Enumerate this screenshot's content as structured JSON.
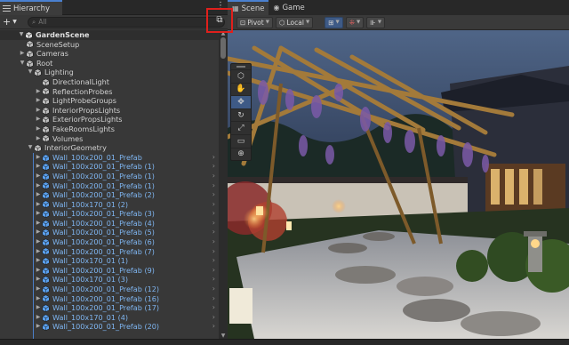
{
  "hierarchy": {
    "tab_label": "Hierarchy",
    "add_label": "+",
    "search_placeholder": "All",
    "items": [
      {
        "label": "GardenScene",
        "indent": 0,
        "arrow": "down",
        "kind": "scene"
      },
      {
        "label": "SceneSetup",
        "indent": 1,
        "arrow": "",
        "kind": "normal"
      },
      {
        "label": "Cameras",
        "indent": 1,
        "arrow": "right",
        "kind": "normal"
      },
      {
        "label": "Root",
        "indent": 1,
        "arrow": "down",
        "kind": "normal"
      },
      {
        "label": "Lighting",
        "indent": 2,
        "arrow": "down",
        "kind": "normal"
      },
      {
        "label": "DirectionalLight",
        "indent": 3,
        "arrow": "",
        "kind": "normal"
      },
      {
        "label": "ReflectionProbes",
        "indent": 3,
        "arrow": "right",
        "kind": "normal"
      },
      {
        "label": "LightProbeGroups",
        "indent": 3,
        "arrow": "right",
        "kind": "normal"
      },
      {
        "label": "InteriorPropsLights",
        "indent": 3,
        "arrow": "right",
        "kind": "normal"
      },
      {
        "label": "ExteriorPropsLights",
        "indent": 3,
        "arrow": "right",
        "kind": "normal"
      },
      {
        "label": "FakeRoomsLights",
        "indent": 3,
        "arrow": "right",
        "kind": "normal"
      },
      {
        "label": "Volumes",
        "indent": 3,
        "arrow": "right",
        "kind": "normal"
      },
      {
        "label": "InteriorGeometry",
        "indent": 2,
        "arrow": "down",
        "kind": "normal"
      },
      {
        "label": "Wall_100x200_01_Prefab",
        "indent": 3,
        "arrow": "right",
        "kind": "prefab"
      },
      {
        "label": "Wall_100x200_01_Prefab (1)",
        "indent": 3,
        "arrow": "right",
        "kind": "prefab"
      },
      {
        "label": "Wall_100x200_01_Prefab (1)",
        "indent": 3,
        "arrow": "right",
        "kind": "prefab"
      },
      {
        "label": "Wall_100x200_01_Prefab (1)",
        "indent": 3,
        "arrow": "right",
        "kind": "prefab"
      },
      {
        "label": "Wall_100x200_01_Prefab (2)",
        "indent": 3,
        "arrow": "right",
        "kind": "prefab"
      },
      {
        "label": "Wall_100x170_01 (2)",
        "indent": 3,
        "arrow": "right",
        "kind": "prefab"
      },
      {
        "label": "Wall_100x200_01_Prefab (3)",
        "indent": 3,
        "arrow": "right",
        "kind": "prefab"
      },
      {
        "label": "Wall_100x200_01_Prefab (4)",
        "indent": 3,
        "arrow": "right",
        "kind": "prefab"
      },
      {
        "label": "Wall_100x200_01_Prefab (5)",
        "indent": 3,
        "arrow": "right",
        "kind": "prefab"
      },
      {
        "label": "Wall_100x200_01_Prefab (6)",
        "indent": 3,
        "arrow": "right",
        "kind": "prefab"
      },
      {
        "label": "Wall_100x200_01_Prefab (7)",
        "indent": 3,
        "arrow": "right",
        "kind": "prefab"
      },
      {
        "label": "Wall_100x170_01 (1)",
        "indent": 3,
        "arrow": "right",
        "kind": "prefab"
      },
      {
        "label": "Wall_100x200_01_Prefab (9)",
        "indent": 3,
        "arrow": "right",
        "kind": "prefab"
      },
      {
        "label": "Wall_100x170_01 (3)",
        "indent": 3,
        "arrow": "right",
        "kind": "prefab"
      },
      {
        "label": "Wall_100x200_01_Prefab (12)",
        "indent": 3,
        "arrow": "right",
        "kind": "prefab"
      },
      {
        "label": "Wall_100x200_01_Prefab (16)",
        "indent": 3,
        "arrow": "right",
        "kind": "prefab"
      },
      {
        "label": "Wall_100x200_01_Prefab (17)",
        "indent": 3,
        "arrow": "right",
        "kind": "prefab"
      },
      {
        "label": "Wall_100x170_01 (4)",
        "indent": 3,
        "arrow": "right",
        "kind": "prefab"
      },
      {
        "label": "Wall_100x200_01_Prefab (20)",
        "indent": 3,
        "arrow": "right",
        "kind": "prefab"
      }
    ]
  },
  "scene_view": {
    "tabs": [
      {
        "label": "Scene",
        "icon": "grid-icon",
        "active": true
      },
      {
        "label": "Game",
        "icon": "gamepad-icon",
        "active": false
      }
    ],
    "toolbar": {
      "pivot_label": "Pivot",
      "local_label": "Local"
    },
    "tools": [
      "view-tool",
      "hand-tool",
      "move-tool",
      "rotate-tool",
      "scale-tool",
      "rect-tool",
      "transform-tool"
    ]
  },
  "colors": {
    "prefab_text": "#7fb6f2",
    "accent": "#4a80d0",
    "highlight": "#e0201c"
  }
}
